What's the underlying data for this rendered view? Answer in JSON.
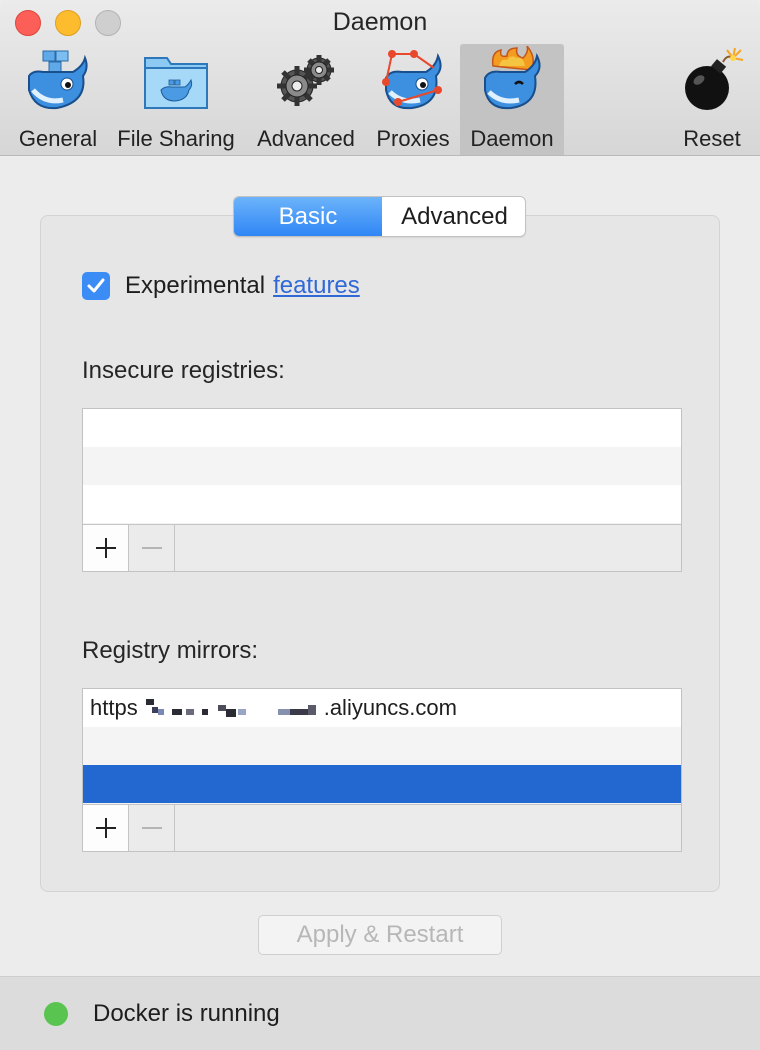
{
  "window": {
    "title": "Daemon"
  },
  "toolbar": {
    "items": [
      {
        "label": "General",
        "icon": "docker-whale-boxes-icon"
      },
      {
        "label": "File Sharing",
        "icon": "docker-folder-icon"
      },
      {
        "label": "Advanced",
        "icon": "gears-icon"
      },
      {
        "label": "Proxies",
        "icon": "docker-whale-network-icon"
      },
      {
        "label": "Daemon",
        "icon": "docker-whale-flame-icon",
        "active": true
      },
      {
        "label": "Reset",
        "icon": "bomb-icon"
      }
    ]
  },
  "tabs": {
    "basic": "Basic",
    "advanced": "Advanced",
    "selected": "Basic"
  },
  "experimental": {
    "label": "Experimental",
    "link": "features",
    "checked": true
  },
  "insecure_registries": {
    "label": "Insecure registries:",
    "entries": []
  },
  "registry_mirrors": {
    "label": "Registry mirrors:",
    "entries": [
      {
        "prefix": "https",
        "suffix": ".aliyuncs.com",
        "redacted": true
      }
    ]
  },
  "list_buttons": {
    "add": "+",
    "remove": "−"
  },
  "apply_button": "Apply & Restart",
  "status": {
    "text": "Docker is running",
    "color": "#5ac451"
  },
  "colors": {
    "accent": "#3b8cf5",
    "selection": "#2368d1",
    "link": "#2f69d8"
  }
}
